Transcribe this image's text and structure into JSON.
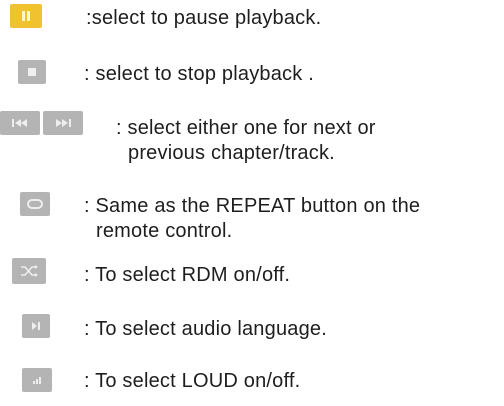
{
  "items": [
    {
      "icon": "pause-icon",
      "accent": "#f1c230",
      "text": ":select to pause playback."
    },
    {
      "icon": "stop-icon",
      "text": ": select to stop playback ."
    },
    {
      "icons": [
        "previous-track-icon",
        "next-track-icon"
      ],
      "lines": [
        ": select either one for next or",
        "previous chapter/track."
      ]
    },
    {
      "icon": "repeat-icon",
      "lines": [
        ": Same as the REPEAT button on the",
        "remote control."
      ]
    },
    {
      "icon": "shuffle-icon",
      "text": ": To select RDM on/off."
    },
    {
      "icon": "audio-language-icon",
      "text": ": To select audio language."
    },
    {
      "icon": "loudness-icon",
      "text": ": To select LOUD on/off."
    }
  ]
}
